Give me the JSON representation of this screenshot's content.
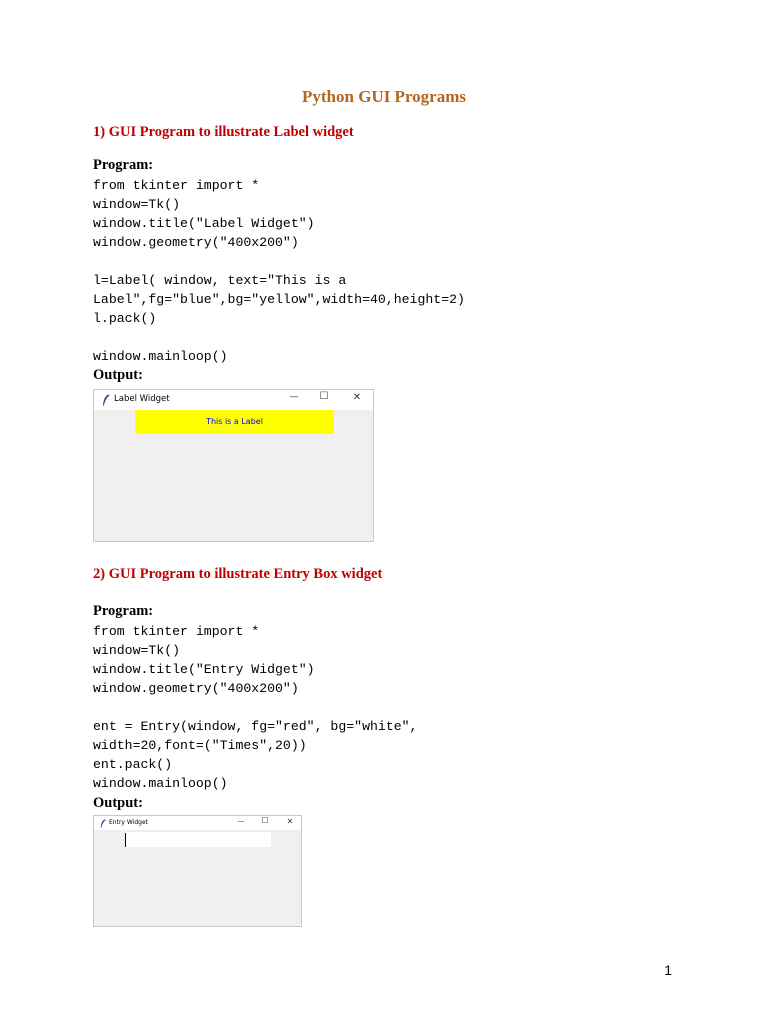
{
  "document": {
    "title": "Python GUI Programs",
    "page_number": "1"
  },
  "section1": {
    "heading": "1) GUI Program to illustrate Label widget",
    "program_label": "Program:",
    "code_lines": [
      "from tkinter import *",
      "window=Tk()",
      "window.title(\"Label Widget\")",
      "window.geometry(\"400x200\")",
      "",
      "l=Label( window, text=\"This is a",
      "Label\",fg=\"blue\",bg=\"yellow\",width=40,height=2)",
      "l.pack()",
      "",
      "window.mainloop()"
    ],
    "output_label": "Output:",
    "window": {
      "title": "Label Widget",
      "minimize_glyph": "—",
      "maximize_glyph": "☐",
      "close_glyph": "✕",
      "label_text": "This is a Label",
      "label_fg": "#0000ff",
      "label_bg": "#ffff00"
    }
  },
  "section2": {
    "heading": "2) GUI Program to illustrate Entry Box widget",
    "program_label": "Program:",
    "code_lines": [
      "from tkinter import *",
      "window=Tk()",
      "window.title(\"Entry Widget\")",
      "window.geometry(\"400x200\")",
      "",
      "ent = Entry(window, fg=\"red\", bg=\"white\",",
      "width=20,font=(\"Times\",20))",
      "ent.pack()",
      "window.mainloop()"
    ],
    "output_label": "Output:",
    "window": {
      "title": "Entry Widget",
      "minimize_glyph": "—",
      "maximize_glyph": "☐",
      "close_glyph": "✕",
      "entry_value": ""
    }
  },
  "colors": {
    "title": "#b5651d",
    "heading": "#c00000",
    "window_bg": "#f0f0f0"
  }
}
